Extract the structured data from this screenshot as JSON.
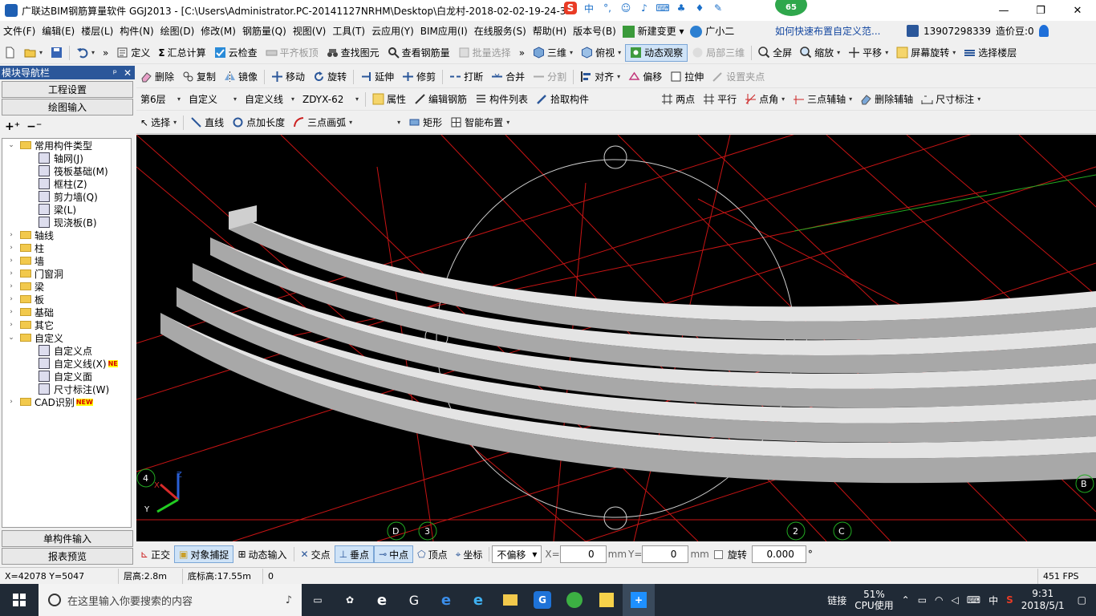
{
  "window": {
    "title": "广联达BIM钢筋算量软件 GGJ2013 - [C:\\Users\\Administrator.PC-20141127NRHM\\Desktop\\白龙村-2018-02-02-19-24-35",
    "ime_label": "中",
    "badge": "65",
    "min": "—",
    "max": "❐",
    "close": "✕"
  },
  "menu": {
    "items": [
      "文件(F)",
      "编辑(E)",
      "楼层(L)",
      "构件(N)",
      "绘图(D)",
      "修改(M)",
      "钢筋量(Q)",
      "视图(V)",
      "工具(T)",
      "云应用(Y)",
      "BIM应用(I)",
      "在线服务(S)",
      "帮助(H)",
      "版本号(B)"
    ],
    "new_change": "新建变更",
    "assistant": "广小二",
    "help_link": "如何快速布置自定义范...",
    "phone": "13907298339",
    "beans": "造价豆:0"
  },
  "toolbar1": {
    "define": "定义",
    "sum": "汇总计算",
    "cloud_check": "云检查",
    "flat_top": "平齐板顶",
    "find": "查找图元",
    "view_rebar": "查看钢筋量",
    "batch": "批量选择",
    "three_d": "三维",
    "top_view": "俯视",
    "dynamic": "动态观察",
    "local_3d": "局部三维",
    "fullscreen": "全屏",
    "zoom": "缩放",
    "pan": "平移",
    "rotate": "屏幕旋转",
    "select_floor": "选择楼层"
  },
  "toolbar2": {
    "delete": "删除",
    "copy": "复制",
    "mirror": "镜像",
    "move": "移动",
    "rotate": "旋转",
    "extend": "延伸",
    "trim": "修剪",
    "break": "打断",
    "merge": "合并",
    "split": "分割",
    "align": "对齐",
    "offset": "偏移",
    "stretch": "拉伸",
    "set_point": "设置夹点"
  },
  "toolbar3": {
    "floor": "第6层",
    "type": "自定义",
    "subtype": "自定义线",
    "name": "ZDYX-62",
    "props": "属性",
    "edit_rebar": "编辑钢筋",
    "comp_list": "构件列表",
    "pick": "拾取构件",
    "two_point": "两点",
    "parallel": "平行",
    "point_angle": "点角",
    "three_axis": "三点辅轴",
    "del_axis": "删除辅轴",
    "dim": "尺寸标注"
  },
  "toolbar4": {
    "select": "选择",
    "line": "直线",
    "point_len": "点加长度",
    "arc": "三点画弧",
    "rect": "矩形",
    "smart": "智能布置"
  },
  "leftpanel": {
    "title": "模块导航栏",
    "pin": "ᵖ",
    "close": "✕",
    "btn_project": "工程设置",
    "btn_draw": "绘图输入",
    "btn_single": "单构件输入",
    "btn_report": "报表预览"
  },
  "tree": [
    {
      "label": "常用构件类型",
      "level": 0,
      "exp": "⌄",
      "kind": "folder"
    },
    {
      "label": "轴网(J)",
      "level": 1,
      "exp": "",
      "kind": "leaf"
    },
    {
      "label": "筏板基础(M)",
      "level": 1,
      "exp": "",
      "kind": "leaf"
    },
    {
      "label": "框柱(Z)",
      "level": 1,
      "exp": "",
      "kind": "leaf"
    },
    {
      "label": "剪力墙(Q)",
      "level": 1,
      "exp": "",
      "kind": "leaf"
    },
    {
      "label": "梁(L)",
      "level": 1,
      "exp": "",
      "kind": "leaf"
    },
    {
      "label": "现浇板(B)",
      "level": 1,
      "exp": "",
      "kind": "leaf"
    },
    {
      "label": "轴线",
      "level": 0,
      "exp": "›",
      "kind": "folder"
    },
    {
      "label": "柱",
      "level": 0,
      "exp": "›",
      "kind": "folder"
    },
    {
      "label": "墙",
      "level": 0,
      "exp": "›",
      "kind": "folder"
    },
    {
      "label": "门窗洞",
      "level": 0,
      "exp": "›",
      "kind": "folder"
    },
    {
      "label": "梁",
      "level": 0,
      "exp": "›",
      "kind": "folder"
    },
    {
      "label": "板",
      "level": 0,
      "exp": "›",
      "kind": "folder"
    },
    {
      "label": "基础",
      "level": 0,
      "exp": "›",
      "kind": "folder"
    },
    {
      "label": "其它",
      "level": 0,
      "exp": "›",
      "kind": "folder"
    },
    {
      "label": "自定义",
      "level": 0,
      "exp": "⌄",
      "kind": "folder"
    },
    {
      "label": "自定义点",
      "level": 1,
      "exp": "",
      "kind": "leaf"
    },
    {
      "label": "自定义线(X)",
      "level": 1,
      "exp": "",
      "kind": "leaf",
      "tag": "NE"
    },
    {
      "label": "自定义面",
      "level": 1,
      "exp": "",
      "kind": "leaf"
    },
    {
      "label": "尺寸标注(W)",
      "level": 1,
      "exp": "",
      "kind": "leaf"
    },
    {
      "label": "CAD识别",
      "level": 0,
      "exp": "›",
      "kind": "folder",
      "tag": "NEW"
    }
  ],
  "canvas": {
    "axis_labels": [
      "4",
      "D",
      "3",
      "2",
      "C",
      "B"
    ],
    "axis_x": "X",
    "axis_y": "Y",
    "axis_z": "Z"
  },
  "bottombar": {
    "ortho": "正交",
    "snap": "对象捕捉",
    "dyn_input": "动态输入",
    "intersect": "交点",
    "perp": "垂点",
    "mid": "中点",
    "vertex": "顶点",
    "coord": "坐标",
    "offset_mode": "不偏移",
    "x_label": "X=",
    "x_val": "0",
    "y_label": "Y=",
    "y_val": "0",
    "unit": "mm",
    "rotate_label": "旋转",
    "rotate_val": "0.000",
    "deg": "°"
  },
  "status": {
    "coords": "X=42078 Y=5047",
    "floor_h": "层高:2.8m",
    "base_h": "底标高:17.55m",
    "extra": "0",
    "fps": "451 FPS"
  },
  "taskbar": {
    "search_placeholder": "在这里输入你要搜索的内容",
    "network": "链接",
    "cpu_pct": "51%",
    "cpu_label": "CPU使用",
    "ime": "中",
    "time": "9:31",
    "date": "2018/5/1"
  }
}
